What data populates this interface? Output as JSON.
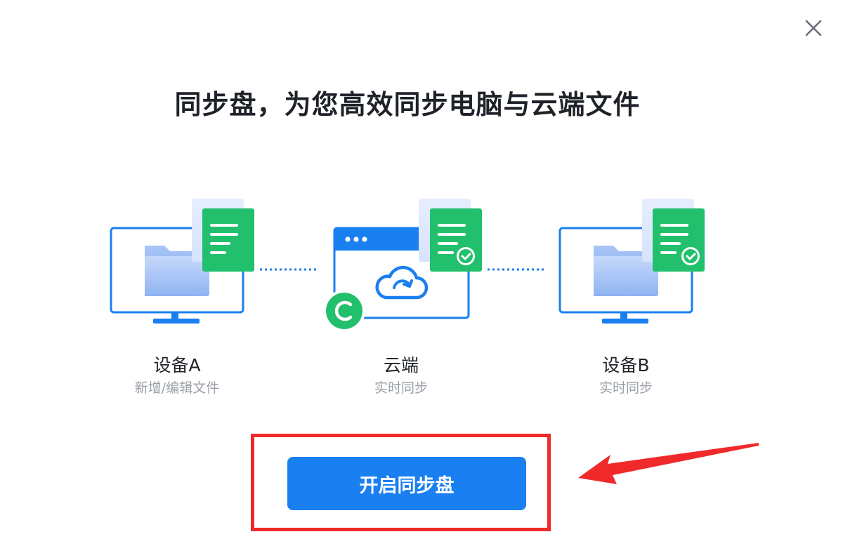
{
  "dialog": {
    "title": "同步盘，为您高效同步电脑与云端文件",
    "close_icon": "close-icon"
  },
  "steps": [
    {
      "title": "设备A",
      "subtitle": "新增/编辑文件",
      "icon": "monitor-folder-document-icon"
    },
    {
      "title": "云端",
      "subtitle": "实时同步",
      "icon": "cloud-window-sync-icon"
    },
    {
      "title": "设备B",
      "subtitle": "实时同步",
      "icon": "monitor-folder-synced-document-icon"
    }
  ],
  "action": {
    "label": "开启同步盘"
  },
  "colors": {
    "accent_blue": "#1a7ff0",
    "green": "#22c06d",
    "highlight_red": "#f0292a",
    "title_text": "#1f2329",
    "sub_text": "#9aa0a8"
  }
}
